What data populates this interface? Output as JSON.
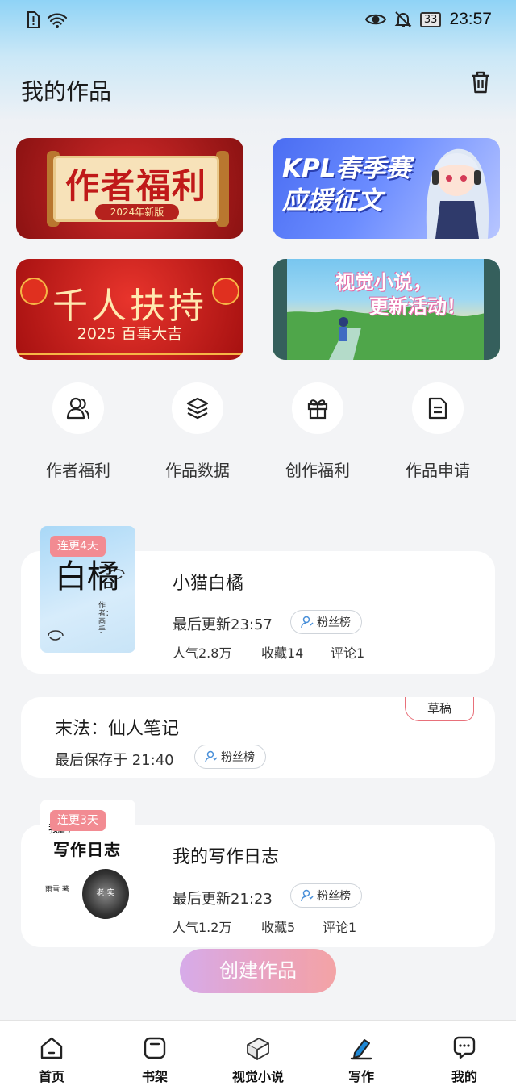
{
  "status": {
    "battery": "33",
    "time": "23:57"
  },
  "header": {
    "title": "我的作品"
  },
  "banners": [
    {
      "title": "作者福利",
      "tag": "2024年新版"
    },
    {
      "line1": "KPL春季赛",
      "line2": "应援征文"
    },
    {
      "title": "千人扶持",
      "sub": "2025 百事大吉"
    },
    {
      "line1": "视觉小说，",
      "line2": "更新活动！"
    }
  ],
  "quick_actions": [
    {
      "label": "作者福利",
      "icon": "author-icon"
    },
    {
      "label": "作品数据",
      "icon": "layers-icon"
    },
    {
      "label": "创作福利",
      "icon": "gift-icon"
    },
    {
      "label": "作品申请",
      "icon": "document-icon"
    }
  ],
  "works": [
    {
      "badge": "连更4天",
      "name": "小猫白橘",
      "updated": "最后更新23:57",
      "fans": "粉丝榜",
      "popularity": "人气2.8万",
      "favorites": "收藏14",
      "comments": "评论1",
      "cover_text": "白橘",
      "cover_author": "作者：画手"
    },
    {
      "draft_tag": "草稿",
      "name": "末法：仙人笔记",
      "saved": "最后保存于 21:40",
      "fans": "粉丝榜"
    },
    {
      "badge": "连更3天",
      "name": "我的写作日志",
      "updated": "最后更新21:23",
      "fans": "粉丝榜",
      "popularity": "人气1.2万",
      "favorites": "收藏5",
      "comments": "评论1",
      "cover_title_small": "我的",
      "cover_title": "写作日志",
      "cover_author": "雨雪 著",
      "cover_stamp": "老 实"
    }
  ],
  "create_button": "创建作品",
  "nav": [
    {
      "label": "首页",
      "icon": "home-icon"
    },
    {
      "label": "书架",
      "icon": "bookshelf-icon"
    },
    {
      "label": "视觉小说",
      "icon": "visual-novel-icon"
    },
    {
      "label": "写作",
      "icon": "write-icon"
    },
    {
      "label": "我的",
      "icon": "chat-icon"
    }
  ]
}
